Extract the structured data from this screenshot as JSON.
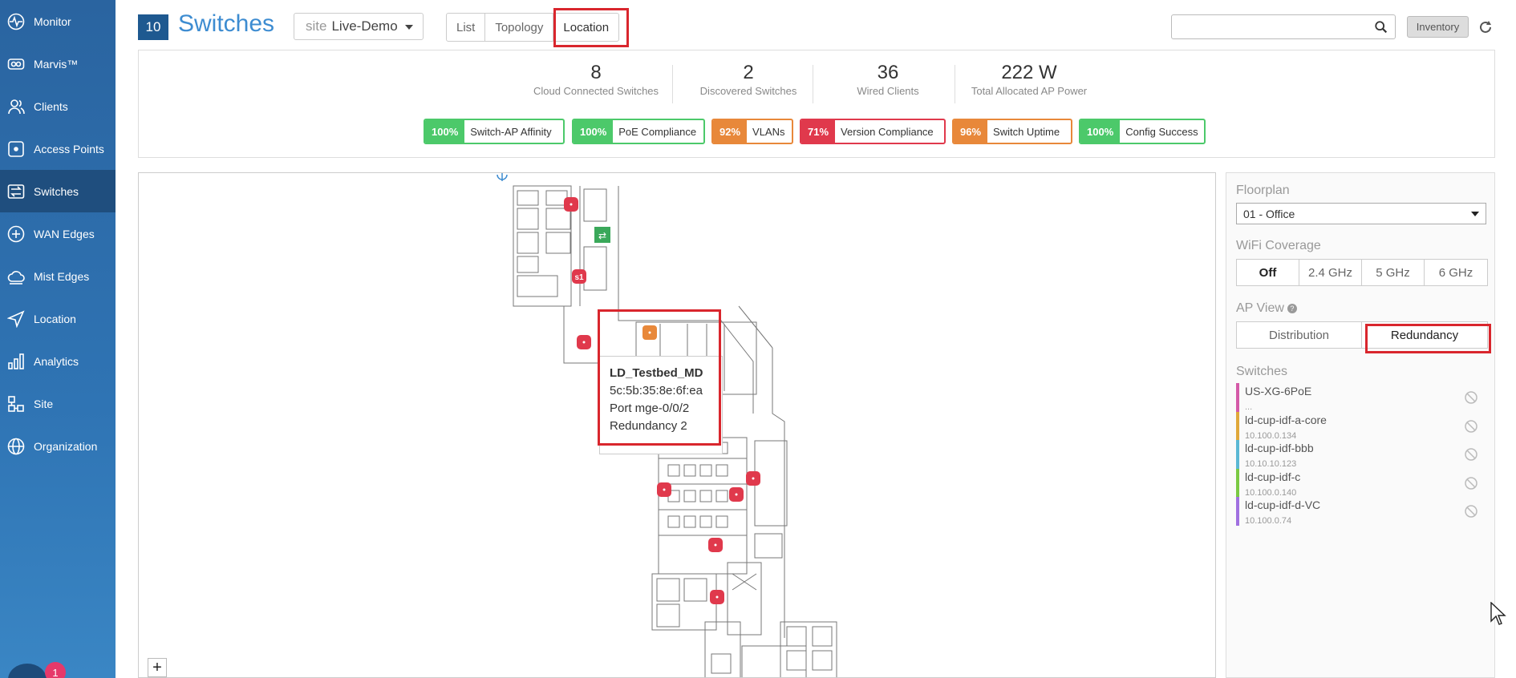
{
  "sidebar": {
    "items": [
      {
        "label": "Monitor",
        "icon": "activity-icon"
      },
      {
        "label": "Marvis™",
        "icon": "marvis-icon"
      },
      {
        "label": "Clients",
        "icon": "users-icon"
      },
      {
        "label": "Access Points",
        "icon": "access-point-icon"
      },
      {
        "label": "Switches",
        "icon": "switch-icon"
      },
      {
        "label": "WAN Edges",
        "icon": "wan-edge-icon"
      },
      {
        "label": "Mist Edges",
        "icon": "cloud-icon"
      },
      {
        "label": "Location",
        "icon": "location-arrow-icon"
      },
      {
        "label": "Analytics",
        "icon": "bar-chart-icon"
      },
      {
        "label": "Site",
        "icon": "site-icon"
      },
      {
        "label": "Organization",
        "icon": "globe-icon"
      }
    ],
    "active_index": 4,
    "notification_count": "1"
  },
  "header": {
    "count": "10",
    "title": "Switches",
    "site_label": "site",
    "site_value": "Live-Demo",
    "tabs": [
      "List",
      "Topology",
      "Location"
    ],
    "active_tab": "Location",
    "search_placeholder": "",
    "inventory_label": "Inventory"
  },
  "stats": [
    {
      "value": "8",
      "label": "Cloud Connected Switches"
    },
    {
      "value": "2",
      "label": "Discovered Switches"
    },
    {
      "value": "36",
      "label": "Wired Clients"
    },
    {
      "value": "222 W",
      "label": "Total Allocated AP Power"
    }
  ],
  "sle_badges": [
    {
      "percent": "100%",
      "label": "Switch-AP Affinity",
      "status": "green"
    },
    {
      "percent": "100%",
      "label": "PoE Compliance",
      "status": "green"
    },
    {
      "percent": "92%",
      "label": "VLANs",
      "status": "orange"
    },
    {
      "percent": "71%",
      "label": "Version Compliance",
      "status": "red"
    },
    {
      "percent": "96%",
      "label": "Switch Uptime",
      "status": "orange"
    },
    {
      "percent": "100%",
      "label": "Config Success",
      "status": "green"
    }
  ],
  "colors": {
    "green": "#4cc96a",
    "orange": "#e8883a",
    "red": "#e0394c",
    "highlight": "#d9262d",
    "accent": "#3d8cd1"
  },
  "map": {
    "tooltip": {
      "name": "LD_Testbed_MD",
      "mac": "5c:5b:35:8e:6f:ea",
      "port": "Port mge-0/0/2",
      "redundancy": "Redundancy 2"
    },
    "ap_label": "s1",
    "zoom_in_label": "+"
  },
  "right_panel": {
    "floorplan_label": "Floorplan",
    "floorplan_value": "01 - Office",
    "wifi_label": "WiFi Coverage",
    "wifi_options": [
      "Off",
      "2.4 GHz",
      "5 GHz",
      "6 GHz"
    ],
    "wifi_active": "Off",
    "ap_view_label": "AP View",
    "ap_view_options": [
      "Distribution",
      "Redundancy"
    ],
    "ap_view_active": "Redundancy",
    "switches_label": "Switches",
    "switches": [
      {
        "name": "US-XG-6PoE",
        "ip": "...",
        "color": "#d45aa8"
      },
      {
        "name": "ld-cup-idf-a-core",
        "ip": "10.100.0.134",
        "color": "#e0a83a"
      },
      {
        "name": "ld-cup-idf-bbb",
        "ip": "10.10.10.123",
        "color": "#5ab8d4"
      },
      {
        "name": "ld-cup-idf-c",
        "ip": "10.100.0.140",
        "color": "#7ac943"
      },
      {
        "name": "ld-cup-idf-d-VC",
        "ip": "10.100.0.74",
        "color": "#a070e0"
      }
    ]
  }
}
